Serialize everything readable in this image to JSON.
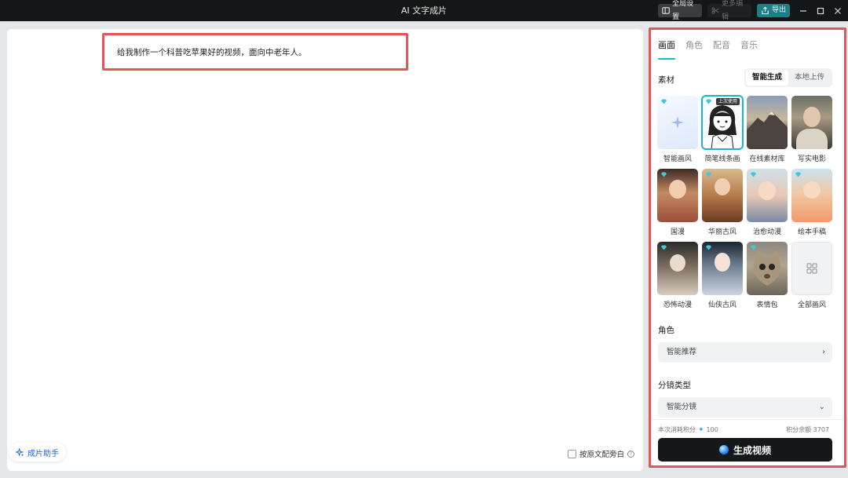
{
  "window": {
    "title": "AI 文字成片",
    "global_settings": "全局设置",
    "more_edit": "更多编辑",
    "export": "导出"
  },
  "editor": {
    "prompt": "给我制作一个科普吃苹果好的视频，面向中老年人。",
    "assistant": "成片助手",
    "narration_label": "按原文配旁白",
    "help": "?"
  },
  "panel": {
    "tabs": [
      "画面",
      "角色",
      "配音",
      "音乐"
    ],
    "material_title": "素材",
    "source_modes": [
      "智能生成",
      "本地上传"
    ],
    "styles": [
      {
        "label": "智能画风",
        "icon": "sparkle-icon"
      },
      {
        "label": "简笔线条画",
        "badge": "上次使用",
        "selected": true
      },
      {
        "label": "在线素材库"
      },
      {
        "label": "写实电影"
      },
      {
        "label": "国漫"
      },
      {
        "label": "华丽古风"
      },
      {
        "label": "治愈动漫"
      },
      {
        "label": "绘本手稿"
      },
      {
        "label": "恐怖动漫"
      },
      {
        "label": "仙侠古风"
      },
      {
        "label": "表情包"
      },
      {
        "label": "全部画风",
        "icon": "grid-icon"
      }
    ],
    "role_title": "角色",
    "role_value": "智能推荐",
    "shot_title": "分镜类型",
    "shot_value": "智能分镜",
    "cost_label": "本次消耗积分",
    "cost_value": "100",
    "balance": "积分余额 3707",
    "generate": "生成视频"
  },
  "colors": {
    "accent": "#1ab7c8",
    "highlight_border": "#e4555a",
    "primary_button": "#15171a",
    "export_button": "#1f7f86"
  }
}
